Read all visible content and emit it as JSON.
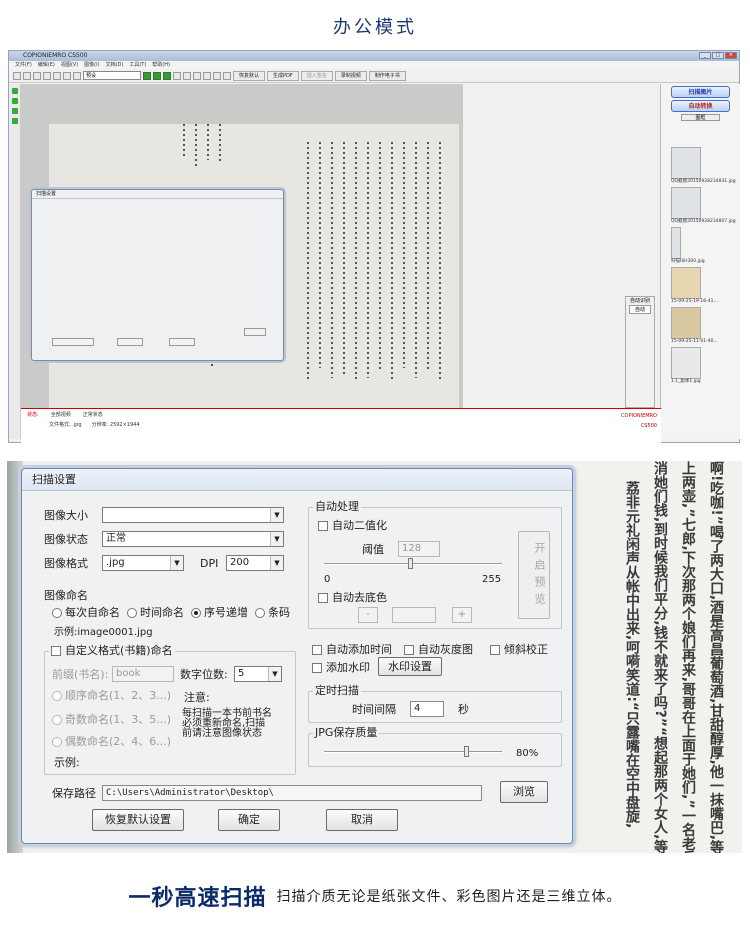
{
  "header": {
    "title": "办公模式"
  },
  "app": {
    "window_title": "COPIONIEMRO CS500",
    "menu": [
      "文件(F)",
      "编辑(E)",
      "视图(V)",
      "图像(I)",
      "文档(D)",
      "工具(T)",
      "帮助(H)"
    ],
    "toolbar": {
      "combo_value": "预设",
      "btn_recover": "恢复默认",
      "btn_pdf": "生成PDF",
      "btn_sign": "插入签名",
      "btn_video": "录制视频",
      "btn_ebook": "制作电子书"
    },
    "right_panel": {
      "scan_button": "扫描图片",
      "auto_button": "自动转换",
      "small_button": "图框",
      "thumbnails": [
        {
          "caption": "QQ截图20150928234831.jpg"
        },
        {
          "caption": "QQ截图20150928234807.jpg"
        },
        {
          "caption": "扫描ISH300.jpg"
        },
        {
          "caption": "15-09-25-19-16-41..."
        },
        {
          "caption": "15-09-25-11-01-40..."
        },
        {
          "caption": "1.1_副本1.jpg"
        }
      ],
      "side_label": "自动识别",
      "side_value": "自动"
    },
    "statusbar": {
      "state_label": "状态:",
      "view": "全部视频",
      "mode": "正常状态",
      "brand": "COPIONIEMRO",
      "model": "CS500",
      "file_format": "文件格式: .jpg",
      "resolution": "分辨率: 2592×1944"
    },
    "mini_dialog_title": "扫描设置"
  },
  "dialog": {
    "title": "扫描设置",
    "image_size_label": "图像大小",
    "image_size_value": "",
    "image_state_label": "图像状态",
    "image_state_value": "正常",
    "image_format_label": "图像格式",
    "image_format_value": ".jpg",
    "dpi_label": "DPI",
    "dpi_value": "200",
    "naming": {
      "group_title": "图像命名",
      "options": [
        "每次自命名",
        "时间命名",
        "序号递增",
        "条码"
      ],
      "selected": 2,
      "example": "示例:image0001.jpg"
    },
    "custom": {
      "group_title": "自定义格式(书籍)命名",
      "prefix_label": "前缀(书名):",
      "prefix_value": "book",
      "digits_label": "数字位数:",
      "digits_value": "5",
      "options": [
        "顺序命名(1、2、3...)",
        "奇数命名(1、3、5...)",
        "偶数命名(2、4、6...)"
      ],
      "note_title": "注意:",
      "note_text": "每扫描一本书前书名必须重新命名,扫描前请注意图像状态",
      "example_label": "示例:"
    },
    "auto": {
      "group_title": "自动处理",
      "binarize": "自动二值化",
      "threshold_label": "阈值",
      "threshold_value": "128",
      "range_min": "0",
      "range_max": "255",
      "remove_bg": "自动去底色",
      "preview_button": "开启预览",
      "minus": "-",
      "plus": "+"
    },
    "checks": {
      "add_time": "自动添加时间",
      "gray": "自动灰度图",
      "deskew": "倾斜校正",
      "watermark": "添加水印",
      "watermark_button": "水印设置"
    },
    "timer": {
      "group_title": "定时扫描",
      "interval_label": "时间间隔",
      "interval_value": "4",
      "unit": "秒"
    },
    "jpg": {
      "group_title": "JPG保存质量",
      "quality_text": "80%",
      "quality": 0.8
    },
    "save_path_label": "保存路径",
    "save_path_value": "C:\\Users\\Administrator\\Desktop\\",
    "browse_button": "浏览",
    "reset_button": "恢复默认设置",
    "ok_button": "确定",
    "cancel_button": "取消"
  },
  "background_text": [
    "啊!吃咖!”喝了两大口,酒是高昌葡萄酒,甘甜醇厚,他一抹嘴巴,等",
    "上两壶,”七郎,下次那两个娘们再来,哥哥在上面于她们,”一名老兵嘿嘿地于",
    "消她们钱,到时候我们平分,钱不就来了吗?”“想起那两个女人,等着弟",
    "荔非元礼闲声从帐中出来,呵嗬笑道:“只露嘴在空中盘旋,"
  ],
  "footer": {
    "headline": "一秒高速扫描",
    "description": "扫描介质无论是纸张文件、彩色图片还是三维立体。"
  }
}
